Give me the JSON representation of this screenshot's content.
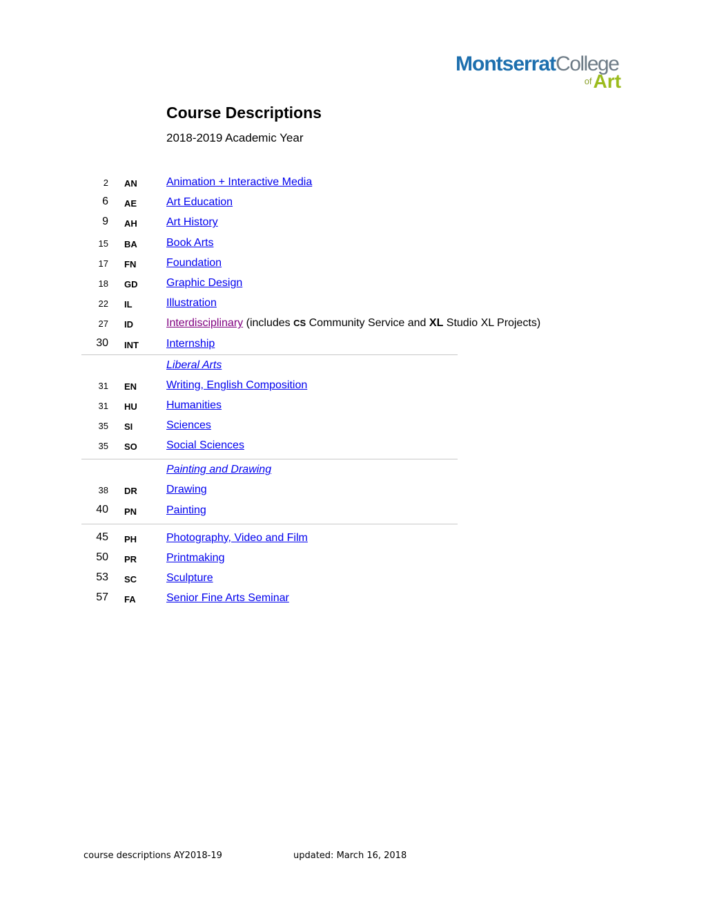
{
  "logo": {
    "line1_bold": "Montserrat",
    "line1_light": "College",
    "line2_small": "of",
    "line2_bold": "Art",
    "colors": {
      "blue": "#1d6fae",
      "gray": "#6d7b86",
      "green": "#9bbb1c"
    }
  },
  "header": {
    "title": "Course Descriptions",
    "subtitle": "2018-2019 Academic Year"
  },
  "toc": {
    "group1": [
      {
        "page": "2",
        "code": "AN",
        "name": "Animation + Interactive Media"
      },
      {
        "page": "6",
        "code": "AE",
        "name": "Art Education"
      },
      {
        "page": "9",
        "code": "AH",
        "name": "Art History"
      },
      {
        "page": "15",
        "code": "BA",
        "name": "Book Arts"
      },
      {
        "page": "17",
        "code": "FN",
        "name": "Foundation"
      },
      {
        "page": "18",
        "code": "GD",
        "name": "Graphic Design"
      },
      {
        "page": "22",
        "code": "IL",
        "name": "Illustration"
      },
      {
        "page": "27",
        "code": "ID",
        "name": "Interdisciplinary",
        "note_pre": "(includes ",
        "note_code1": "CS",
        "note_mid": " Community Service and ",
        "note_code2": "XL",
        "note_post": " Studio XL Projects)"
      },
      {
        "page": "30",
        "code": "INT",
        "name": "Internship"
      }
    ],
    "liberal_arts": {
      "heading": "Liberal Arts",
      "items": [
        {
          "page": "31",
          "code": "EN",
          "name": "Writing, English Composition"
        },
        {
          "page": "31",
          "code": "HU",
          "name": "Humanities"
        },
        {
          "page": "35",
          "code": "SI",
          "name": "Sciences"
        },
        {
          "page": "35",
          "code": "SO",
          "name": "Social Sciences"
        }
      ]
    },
    "painting_drawing": {
      "heading": "Painting and Drawing",
      "items": [
        {
          "page": "38",
          "code": "DR",
          "name": "Drawing"
        },
        {
          "page": "40",
          "code": "PN",
          "name": "Painting"
        }
      ]
    },
    "group4": [
      {
        "page": "45",
        "code": "PH",
        "name": "Photography, Video and Film"
      },
      {
        "page": "50",
        "code": "PR",
        "name": "Printmaking"
      },
      {
        "page": "53",
        "code": "SC",
        "name": "Sculpture"
      },
      {
        "page": "57",
        "code": "FA",
        "name": "Senior Fine Arts Seminar"
      }
    ]
  },
  "footer": {
    "left": "course descriptions AY2018-19",
    "right": "updated: March 16, 2018"
  },
  "colors": {
    "link": "#0000ee",
    "visited_link": "#800080",
    "divider": "#c8c8c8"
  }
}
